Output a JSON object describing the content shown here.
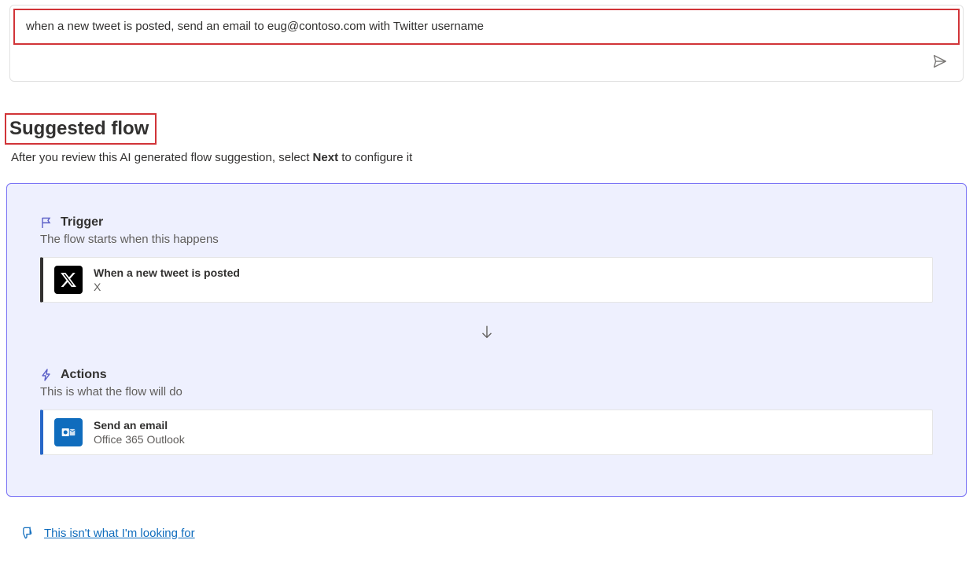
{
  "input": {
    "text": "when a new tweet is posted, send an email to eug@contoso.com with Twitter username"
  },
  "heading": {
    "title": "Suggested flow",
    "subtitle_before": "After you review this AI generated flow suggestion, select ",
    "subtitle_bold": "Next",
    "subtitle_after": " to configure it"
  },
  "trigger_section": {
    "label": "Trigger",
    "description": "The flow starts when this happens",
    "card": {
      "title": "When a new tweet is posted",
      "subtitle": "X"
    }
  },
  "actions_section": {
    "label": "Actions",
    "description": "This is what the flow will do",
    "card": {
      "title": "Send an email",
      "subtitle": "Office 365 Outlook"
    }
  },
  "feedback": {
    "link_text": "This isn't what I'm looking for"
  }
}
